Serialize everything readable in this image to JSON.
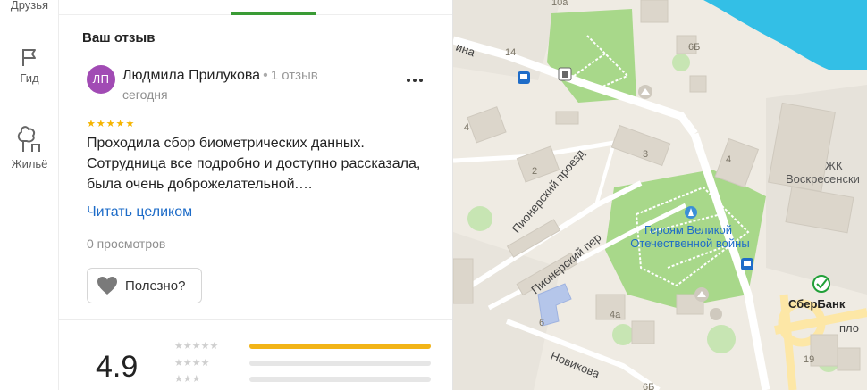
{
  "rail": {
    "friends_label": "Друзья",
    "guide_label": "Гид",
    "housing_label": "Жильё"
  },
  "review_section": {
    "title": "Ваш отзыв",
    "author_initials": "ЛП",
    "author_name": "Людмила Прилукова",
    "author_reviews": "1 отзыв",
    "date": "сегодня",
    "stars": 5,
    "text": "Проходила сбор биометрических данных. Сотрудница все подробно и доступно рассказала, была очень доброжелательной.…",
    "read_more": "Читать целиком",
    "views": "0 просмотров",
    "helpful_label": "Полезно?"
  },
  "rating_summary": {
    "average": "4.9",
    "distribution": [
      {
        "stars": 5,
        "share": 1.0
      },
      {
        "stars": 4,
        "share": 0.0
      },
      {
        "stars": 3,
        "share": 0.0
      }
    ]
  },
  "colors": {
    "accent_green": "#3a9b35",
    "avatar": "#a14bb4",
    "star": "#f5b400",
    "link": "#1e6cc8",
    "park": "#a8d88a",
    "water": "#33bfe6"
  },
  "map": {
    "labels": {
      "street_pionersky_proezd": "Пионерский проезд",
      "street_pionersky_per": "Пионерский пер",
      "street_novikova": "Новикова",
      "street_pl": "пло",
      "street_ina": "ина",
      "park_line1": "Героям Великой",
      "park_line2": "Отечественной войны",
      "complex_line1": "ЖК",
      "complex_line2": "Воскресенски",
      "bank": "СберБанк"
    },
    "house_numbers": [
      "10а",
      "14",
      "6Б",
      "4",
      "2",
      "3",
      "4",
      "6",
      "4а",
      "6Б",
      "19"
    ]
  }
}
